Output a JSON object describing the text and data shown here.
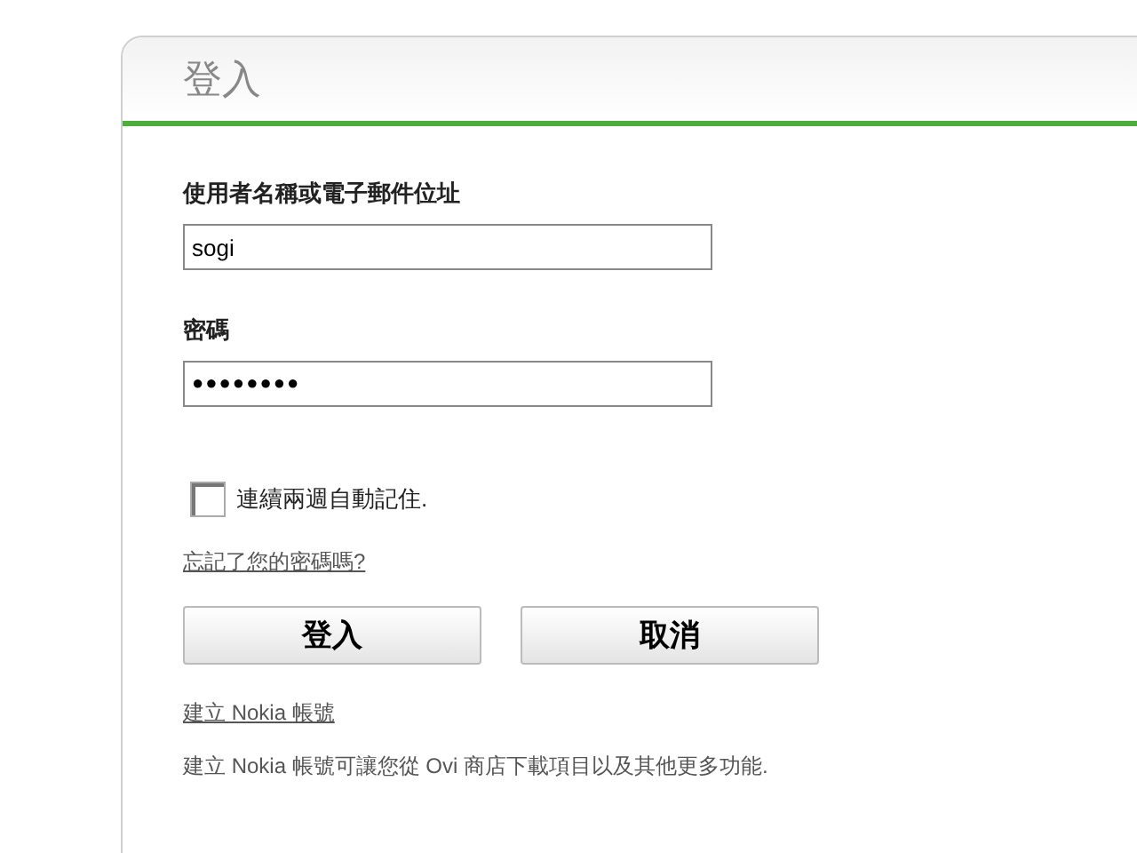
{
  "panel": {
    "title": "登入"
  },
  "username": {
    "label": "使用者名稱或電子郵件位址",
    "value": "sogi"
  },
  "password": {
    "label": "密碼",
    "value": "●●●●●●●●"
  },
  "remember": {
    "label": "連續兩週自動記住.",
    "checked": false
  },
  "forgot_link": "忘記了您的密碼嗎?",
  "buttons": [
    {
      "label": "登入"
    },
    {
      "label": "取消"
    }
  ],
  "create_link": "建立 Nokia 帳號",
  "create_description": "建立 Nokia 帳號可讓您從 Ovi 商店下載項目以及其他更多功能."
}
